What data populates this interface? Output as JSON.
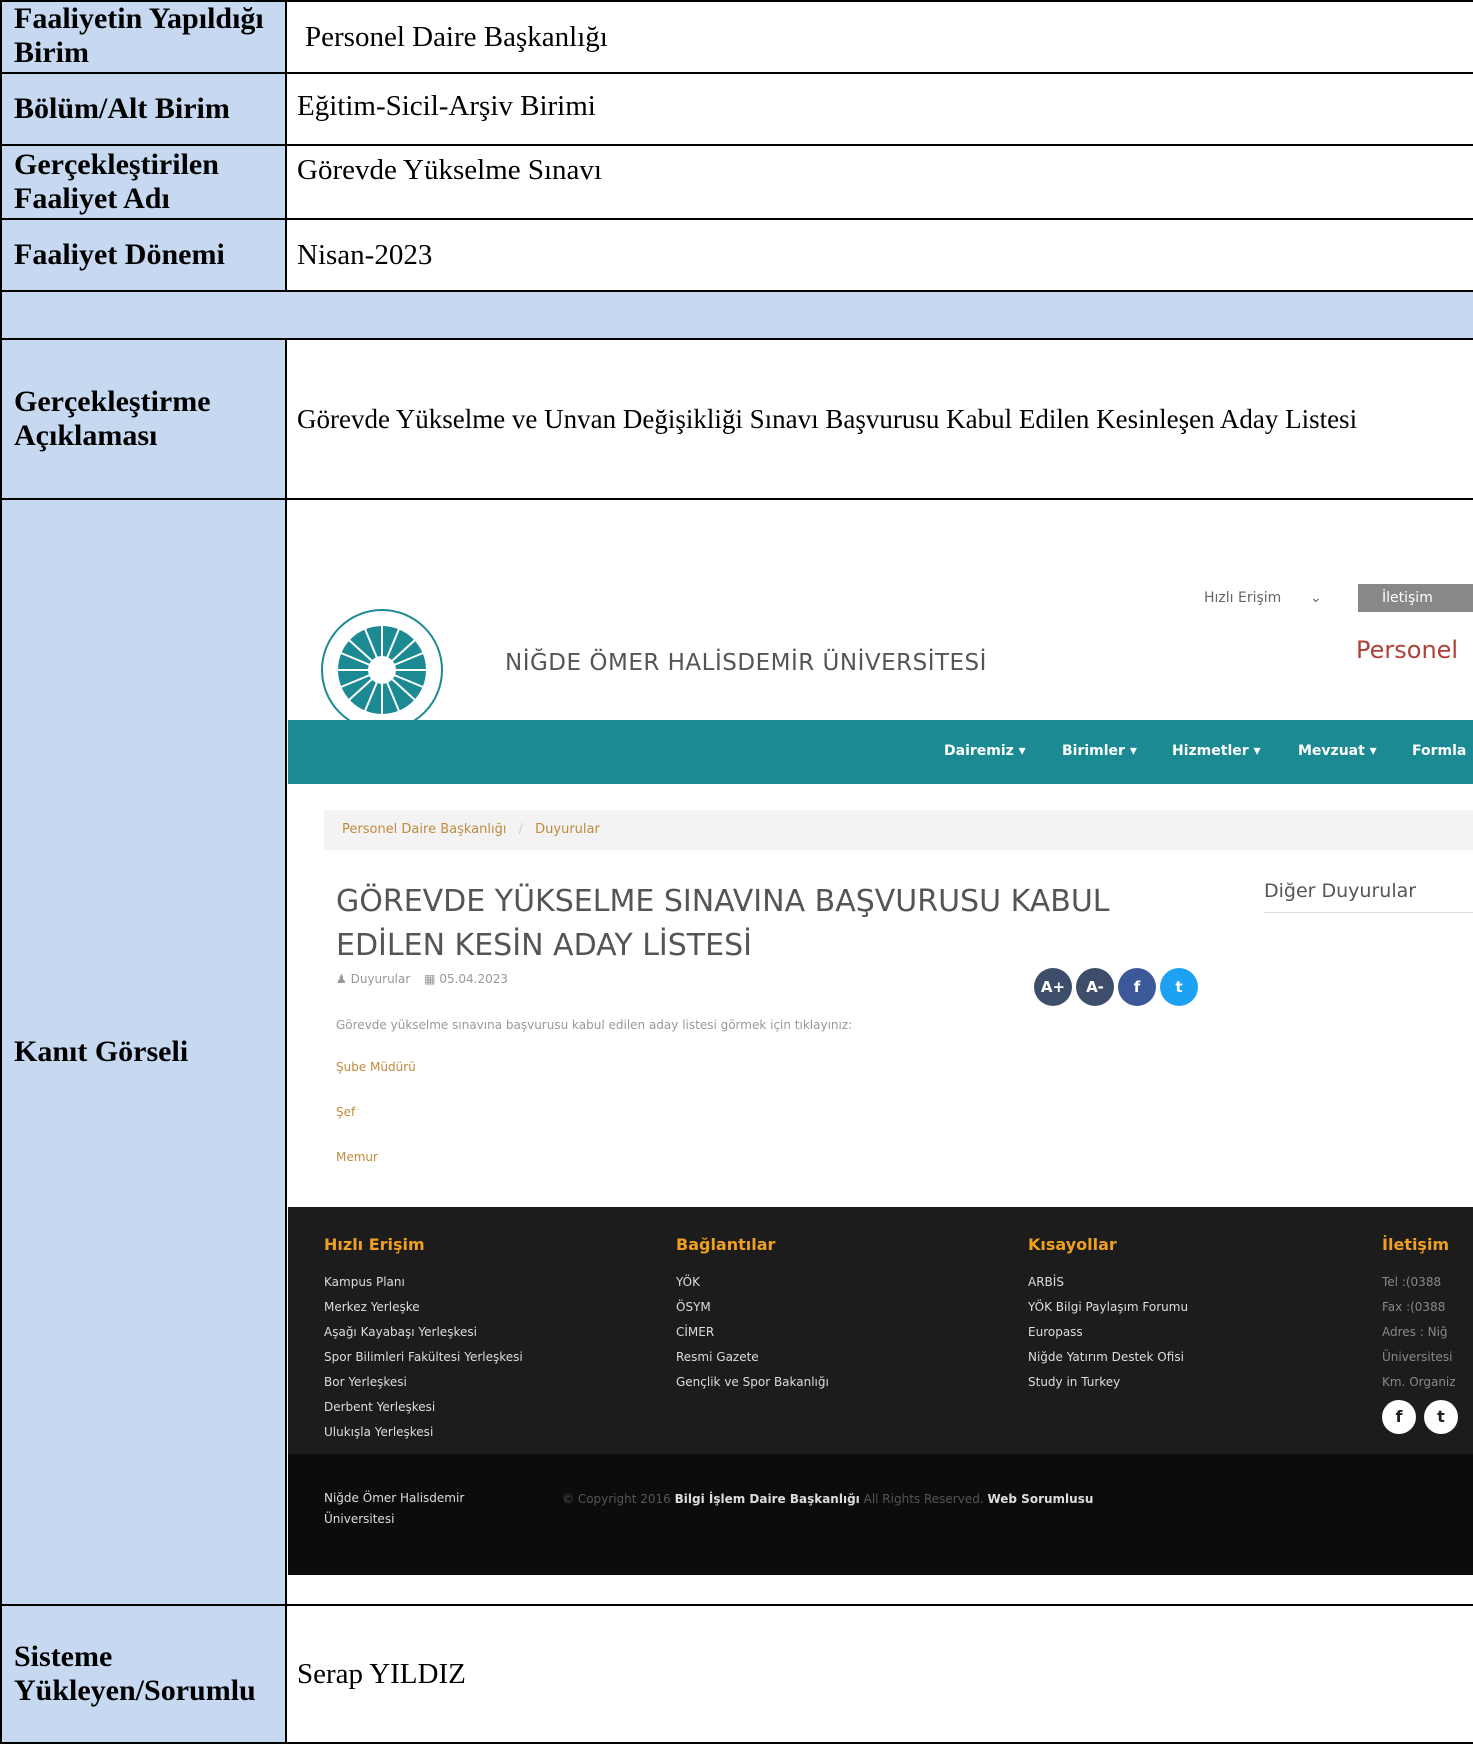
{
  "rows": {
    "birim_label": "Faaliyetin Yapıldığı Birim",
    "birim_value": "Personel Daire Başkanlığı",
    "bolum_label": "Bölüm/Alt Birim",
    "bolum_value": "Eğitim-Sicil-Arşiv Birimi",
    "faaliyet_adi_label": "Gerçekleştirilen Faaliyet Adı",
    "faaliyet_adi_value": "Görevde Yükselme Sınavı",
    "donem_label": "Faaliyet Dönemi",
    "donem_value": "Nisan-2023",
    "aciklama_label": "Gerçekleştirme Açıklaması",
    "aciklama_value": "Görevde Yükselme ve Unvan Değişikliği Sınavı Başvurusu Kabul Edilen Kesinleşen Aday Listesi",
    "kanit_label": "Kanıt Görseli",
    "sorumlu_label": "Sisteme Yükleyen/Sorumlu",
    "sorumlu_value": "Serap YILDIZ"
  },
  "screenshot": {
    "quick_access": "Hızlı Erişim",
    "contact_button": "İletişim",
    "university_name": "NİĞDE ÖMER HALİSDEMİR ÜNİVERSİTESİ",
    "site_title": "Personel",
    "nav": [
      "Dairemiz ▾",
      "Birimler ▾",
      "Hizmetler ▾",
      "Mevzuat ▾",
      "Formla"
    ],
    "breadcrumb_home": "Personel Daire Başkanlığı",
    "breadcrumb_sep": "/",
    "breadcrumb_current": "Duyurular",
    "headline_line1": "GÖREVDE YÜKSELME SINAVINA BAŞVURUSU KABUL",
    "headline_line2": "EDİLEN KESİN ADAY LİSTESİ",
    "meta_category": "Duyurular",
    "meta_date": "05.04.2023",
    "body_text": "Görevde yükselme sınavına başvurusu kabul edilen aday listesi görmek için tıklayınız:",
    "links": [
      "Şube Müdürü",
      "Şef",
      "Memur"
    ],
    "sidebar_title": "Diğer Duyurular",
    "share_icons": [
      "A+",
      "A-",
      "f",
      "t"
    ],
    "footer": {
      "col1_title": "Hızlı Erişim",
      "col1_items": [
        "Kampus Planı",
        "Merkez Yerleşke",
        "Aşağı Kayabaşı Yerleşkesi",
        "Spor Bilimleri Fakültesi Yerleşkesi",
        "Bor Yerleşkesi",
        "Derbent Yerleşkesi",
        "Ulukışla Yerleşkesi"
      ],
      "col2_title": "Bağlantılar",
      "col2_items": [
        "YÖK",
        "ÖSYM",
        "CİMER",
        "Resmi Gazete",
        "Gençlik ve Spor Bakanlığı"
      ],
      "col3_title": "Kısayollar",
      "col3_items": [
        "ARBİS",
        "YÖK Bilgi Paylaşım Forumu",
        "Europass",
        "Niğde Yatırım Destek Ofisi",
        "Study in Turkey"
      ],
      "col4_title": "İletişim",
      "col4_items": [
        "Tel :(0388",
        "Fax :(0388",
        "Adres : Niğ",
        "Üniversitesi",
        "Km. Organiz"
      ],
      "bottom_name_line1": "Niğde Ömer Halisdemir",
      "bottom_name_line2": "Üniversitesi",
      "copyright_prefix": "© Copyright 2016",
      "copyright_dept": "Bilgi İşlem Daire Başkanlığı",
      "copyright_rights": "All Rights Reserved.",
      "webmaster": "Web Sorumlusu"
    }
  }
}
